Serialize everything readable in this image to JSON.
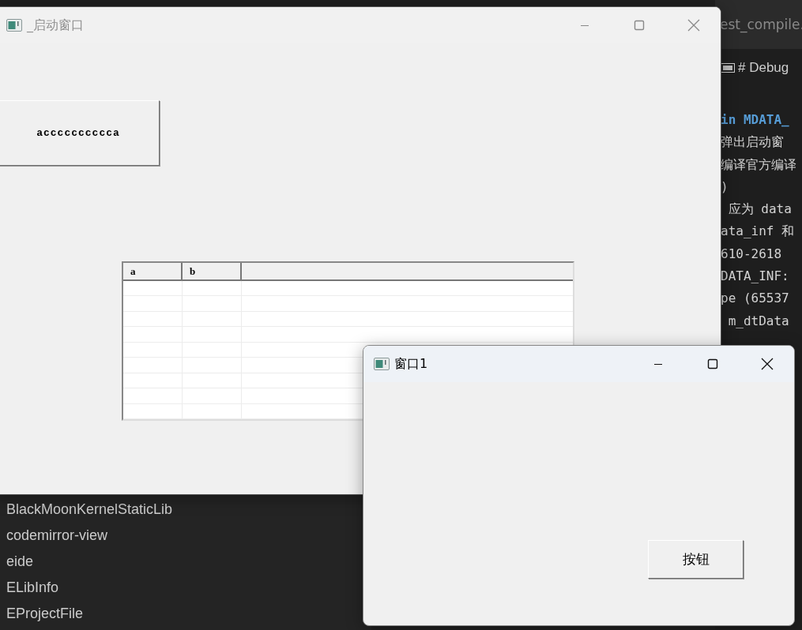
{
  "editor": {
    "tab": "est_compile.",
    "breadcrumb": "# Debug",
    "code_lines": [
      {
        "text": "in MDATA_",
        "kind": "keyword"
      },
      {
        "text": "弹出启动窗",
        "kind": "text"
      },
      {
        "text": "编译官方编译",
        "kind": "text"
      },
      {
        "text": ")",
        "kind": "text"
      },
      {
        "text": " 应为 data",
        "kind": "text"
      },
      {
        "text": "ata_inf 和",
        "kind": "text"
      },
      {
        "text": "610-2618",
        "kind": "text"
      },
      {
        "text": "DATA_INF:",
        "kind": "text"
      },
      {
        "text": "pe (65537",
        "kind": "text"
      },
      {
        "text": " m_dtData",
        "kind": "text"
      }
    ]
  },
  "explorer": {
    "items": [
      "BlackMoonKernelStaticLib",
      "codemirror-view",
      "eide",
      "ELibInfo",
      "EProjectFile"
    ]
  },
  "windows": [
    {
      "title": "_启动窗口",
      "active": false,
      "button": "acccccccccca",
      "table": {
        "columns": [
          "a",
          "b"
        ]
      }
    },
    {
      "title": "窗口1",
      "active": true,
      "button": "按钮"
    }
  ]
}
